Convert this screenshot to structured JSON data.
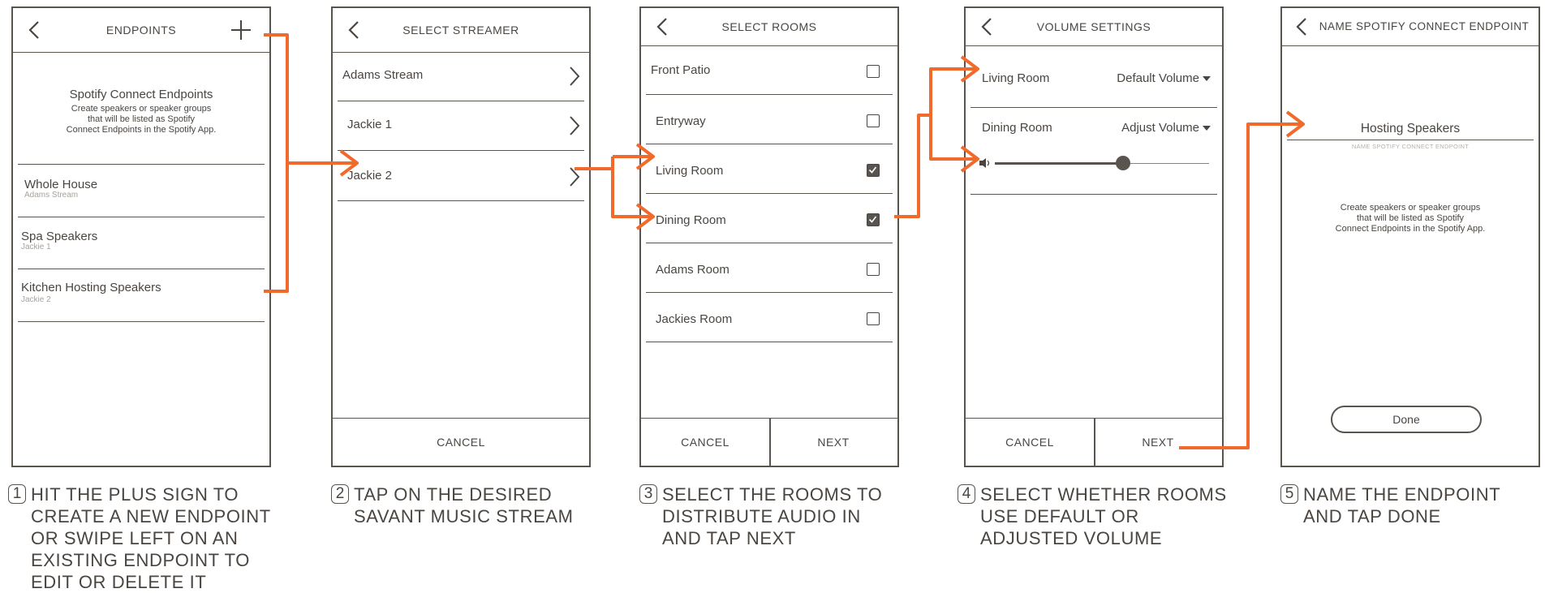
{
  "colors": {
    "accent": "#f26a2b",
    "line": "#5a544e",
    "text": "#4a4540",
    "muted": "#a9a29c"
  },
  "screen1": {
    "title": "ENDPOINTS",
    "heading": "Spotify Connect Endpoints",
    "desc": "Create speakers or speaker groups\nthat will be listed as Spotify\nConnect Endpoints in the Spotify App.",
    "items": [
      {
        "name": "Whole House",
        "sub": "Adams Stream"
      },
      {
        "name": "Spa Speakers",
        "sub": "Jackie 1"
      },
      {
        "name": "Kitchen Hosting Speakers",
        "sub": "Jackie 2"
      }
    ]
  },
  "screen2": {
    "title": "SELECT STREAMER",
    "items": [
      "Adams Stream",
      "Jackie 1",
      "Jackie 2"
    ],
    "cancel": "CANCEL"
  },
  "screen3": {
    "title": "SELECT ROOMS",
    "rooms": [
      {
        "name": "Front Patio",
        "checked": false
      },
      {
        "name": "Entryway",
        "checked": false
      },
      {
        "name": "Living Room",
        "checked": true
      },
      {
        "name": "Dining Room",
        "checked": true
      },
      {
        "name": "Adams Room",
        "checked": false
      },
      {
        "name": "Jackies Room",
        "checked": false
      }
    ],
    "cancel": "CANCEL",
    "next": "NEXT"
  },
  "screen4": {
    "title": "VOLUME SETTINGS",
    "rows": [
      {
        "name": "Living Room",
        "setting": "Default Volume"
      },
      {
        "name": "Dining Room",
        "setting": "Adjust Volume"
      }
    ],
    "volume_level": 0.6,
    "cancel": "CANCEL",
    "next": "NEXT"
  },
  "screen5": {
    "title": "NAME SPOTIFY CONNECT ENDPOINT",
    "name_value": "Hosting Speakers",
    "name_caption": "NAME SPOTIFY CONNECT ENDPOINT",
    "desc": "Create speakers or speaker groups\nthat will be listed as Spotify\nConnect Endpoints in the Spotify App.",
    "done": "Done"
  },
  "steps": [
    {
      "num": "1",
      "text": "HIT THE PLUS SIGN TO\nCREATE A NEW ENDPOINT\nOR SWIPE LEFT ON AN\nEXISTING ENDPOINT TO\nEDIT OR DELETE IT"
    },
    {
      "num": "2",
      "text": "TAP ON THE DESIRED\nSAVANT MUSIC STREAM"
    },
    {
      "num": "3",
      "text": "SELECT THE ROOMS TO\nDISTRIBUTE AUDIO IN\nAND TAP NEXT"
    },
    {
      "num": "4",
      "text": "SELECT WHETHER ROOMS\nUSE  DEFAULT OR\nADJUSTED VOLUME"
    },
    {
      "num": "5",
      "text": "NAME THE ENDPOINT\nAND TAP DONE"
    }
  ]
}
